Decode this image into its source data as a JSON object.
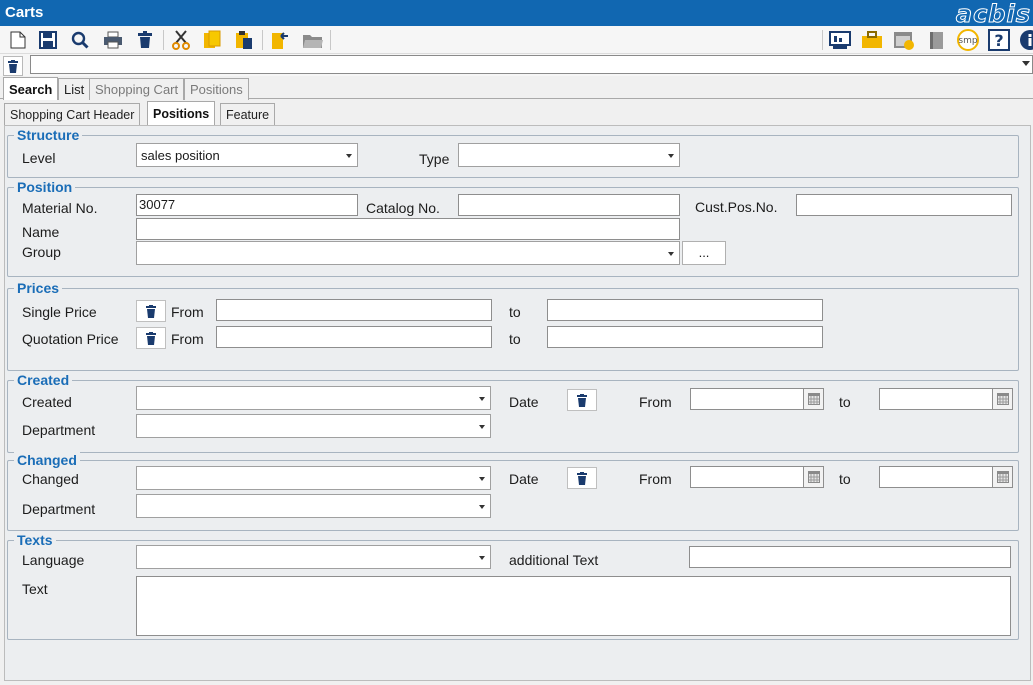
{
  "window": {
    "title": "Carts",
    "logo": "acbis"
  },
  "toolbar": {
    "left": [
      "new-document-icon",
      "save-icon",
      "search-icon",
      "print-icon",
      "delete-icon",
      "cut-icon",
      "copy-icon",
      "paste-icon",
      "import-icon",
      "open-folder-icon"
    ],
    "right": [
      "monitor-icon",
      "briefcase-icon",
      "calendar-check-icon",
      "book-icon",
      "smp-icon",
      "help-icon",
      "info-icon"
    ],
    "smp_label": "smp",
    "help_label": "?"
  },
  "tabs_main": [
    {
      "label": "Search",
      "state": "active"
    },
    {
      "label": "List",
      "state": "normal"
    },
    {
      "label": "Shopping Cart",
      "state": "disabled"
    },
    {
      "label": "Positions",
      "state": "disabled"
    }
  ],
  "tabs_sub": [
    {
      "label": "Shopping Cart Header",
      "state": "normal"
    },
    {
      "label": "Positions",
      "state": "active"
    },
    {
      "label": "Feature",
      "state": "normal"
    }
  ],
  "structure": {
    "legend": "Structure",
    "level_label": "Level",
    "level_value": "sales position",
    "type_label": "Type",
    "type_value": ""
  },
  "position": {
    "legend": "Position",
    "material_label": "Material No.",
    "material_value": "30077",
    "catalog_label": "Catalog No.",
    "catalog_value": "",
    "custpos_label": "Cust.Pos.No.",
    "custpos_value": "",
    "name_label": "Name",
    "name_value": "",
    "group_label": "Group",
    "group_value": "",
    "group_button": "..."
  },
  "prices": {
    "legend": "Prices",
    "single_label": "Single Price",
    "quotation_label": "Quotation Price",
    "from_label": "From",
    "to_label": "to"
  },
  "created": {
    "legend": "Created",
    "created_label": "Created",
    "department_label": "Department",
    "date_label": "Date",
    "from_label": "From",
    "to_label": "to"
  },
  "changed": {
    "legend": "Changed",
    "changed_label": "Changed",
    "department_label": "Department",
    "date_label": "Date",
    "from_label": "From",
    "to_label": "to"
  },
  "texts": {
    "legend": "Texts",
    "language_label": "Language",
    "additional_label": "additional Text",
    "text_label": "Text"
  },
  "colors": {
    "titlebar": "#1167b1",
    "legend": "#1a6db7",
    "accent_yellow": "#f2b600"
  }
}
